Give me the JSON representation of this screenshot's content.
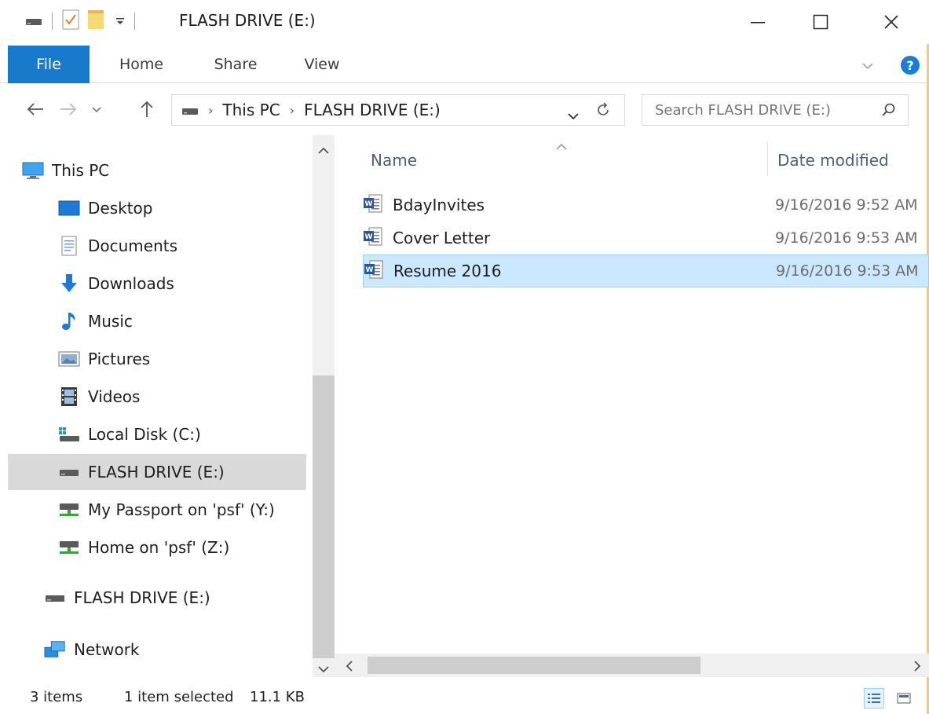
{
  "window": {
    "title": "FLASH DRIVE (E:)",
    "colors": {
      "accent": "#1979ca",
      "selection": "#cce8ff",
      "selection_border": "#99d1ff",
      "help": "#1a7fd4"
    }
  },
  "ribbon": {
    "tabs": [
      {
        "label": "File"
      },
      {
        "label": "Home"
      },
      {
        "label": "Share"
      },
      {
        "label": "View"
      }
    ]
  },
  "address": {
    "crumbs": [
      "This PC",
      "FLASH DRIVE (E:)"
    ]
  },
  "search": {
    "placeholder": "Search FLASH DRIVE (E:)"
  },
  "nav": {
    "items": [
      {
        "label": "This PC",
        "icon": "computer-icon"
      },
      {
        "label": "Desktop",
        "icon": "desktop-icon"
      },
      {
        "label": "Documents",
        "icon": "documents-icon"
      },
      {
        "label": "Downloads",
        "icon": "download-arrow-icon"
      },
      {
        "label": "Music",
        "icon": "music-note-icon"
      },
      {
        "label": "Pictures",
        "icon": "pictures-icon"
      },
      {
        "label": "Videos",
        "icon": "film-icon"
      },
      {
        "label": "Local Disk (C:)",
        "icon": "local-disk-icon"
      },
      {
        "label": "FLASH DRIVE (E:)",
        "icon": "drive-icon"
      },
      {
        "label": "My Passport on 'psf' (Y:)",
        "icon": "network-drive-icon"
      },
      {
        "label": "Home on 'psf' (Z:)",
        "icon": "network-drive-icon"
      },
      {
        "label": "FLASH DRIVE (E:)",
        "icon": "drive-icon"
      },
      {
        "label": "Network",
        "icon": "network-icon"
      }
    ]
  },
  "list": {
    "columns": {
      "name": "Name",
      "date": "Date modified"
    },
    "files": [
      {
        "name": "BdayInvites",
        "date": "9/16/2016 9:52 AM"
      },
      {
        "name": "Cover Letter",
        "date": "9/16/2016 9:53 AM"
      },
      {
        "name": "Resume 2016",
        "date": "9/16/2016 9:53 AM"
      }
    ]
  },
  "status": {
    "count": "3 items",
    "selection": "1 item selected",
    "size": "11.1 KB"
  }
}
